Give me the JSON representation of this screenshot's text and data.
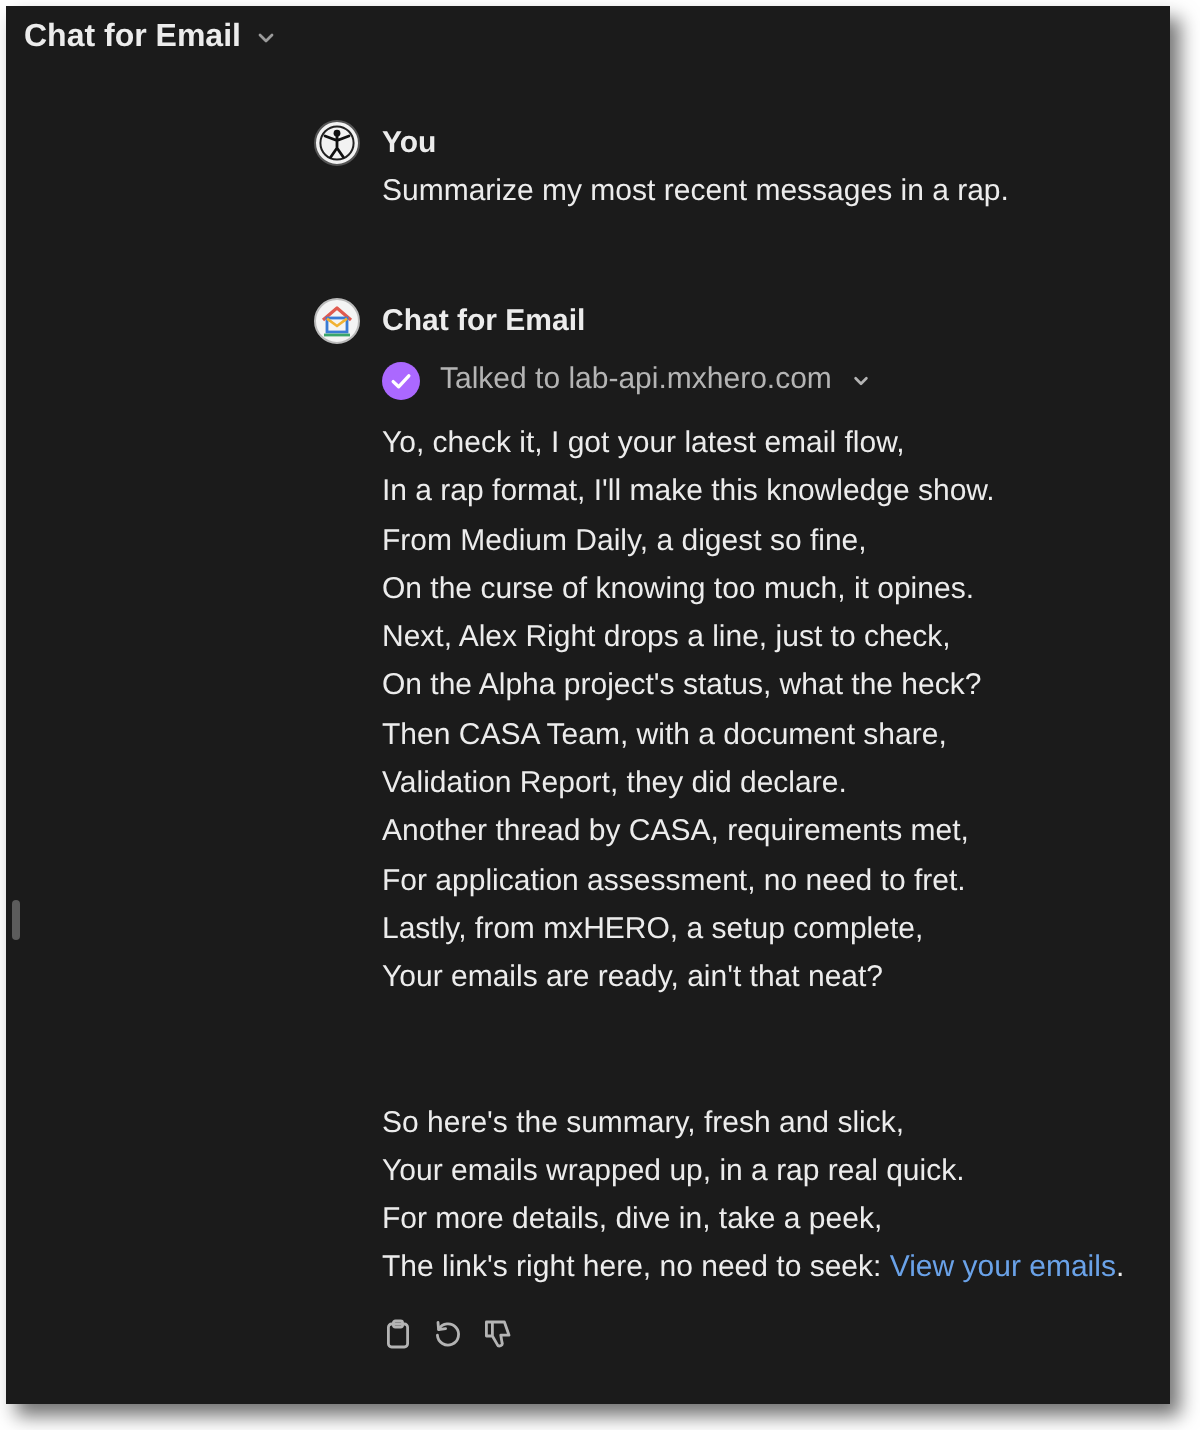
{
  "header": {
    "title": "Chat for Email"
  },
  "messages": [
    {
      "kind": "user",
      "author": "You",
      "text": "Summarize my most recent messages in a rap."
    },
    {
      "kind": "assistant",
      "author": "Chat for Email",
      "tool_call": {
        "label": "Talked to lab-api.mxhero.com"
      },
      "stanzas": [
        {
          "lines": [
            "Yo, check it, I got your latest email flow,",
            "In a rap format, I'll make this knowledge show.",
            "From Medium Daily, a digest so fine,",
            "On the curse of knowing too much, it opines.",
            "Next, Alex Right drops a line, just to check,",
            "On the Alpha project's status, what the heck?",
            "Then CASA Team, with a document share,",
            "Validation Report, they did declare.",
            "Another thread by CASA, requirements met,",
            "For application assessment, no need to fret.",
            "Lastly, from mxHERO, a setup complete,",
            "Your emails are ready, ain't that neat?"
          ]
        },
        {
          "lines": [
            "So here's the summary, fresh and slick,",
            "Your emails wrapped up, in a rap real quick.",
            "For more details, dive in, take a peek,",
            "The link's right here, no need to seek:"
          ],
          "link": {
            "text": "View your emails",
            "after": "."
          }
        }
      ]
    }
  ]
}
